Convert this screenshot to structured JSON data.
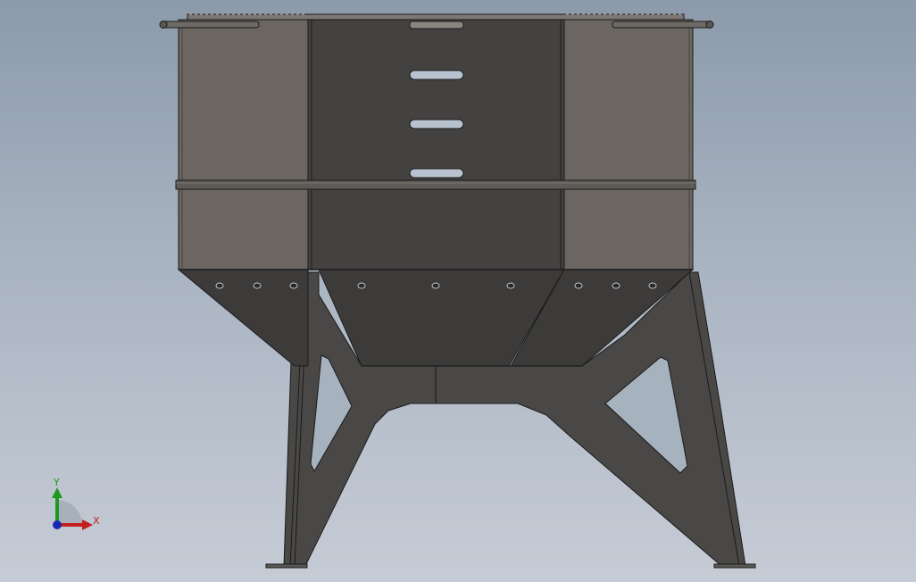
{
  "viewport": {
    "background_top": "#8c9aab",
    "background_bottom": "#c6ccd6"
  },
  "model": {
    "colors": {
      "outline": "#1b1b1b",
      "side_panel": "#6b6661",
      "front_panel": "#444240",
      "hopper": "#3d3b3a",
      "leg": "#4a4846",
      "slot": "#b8c2cf"
    }
  },
  "triad": {
    "y_label": "Y",
    "x_label": "X",
    "y_color": "#1f9a1f",
    "x_color": "#c41e1e",
    "z_color": "#1a2ab0"
  }
}
